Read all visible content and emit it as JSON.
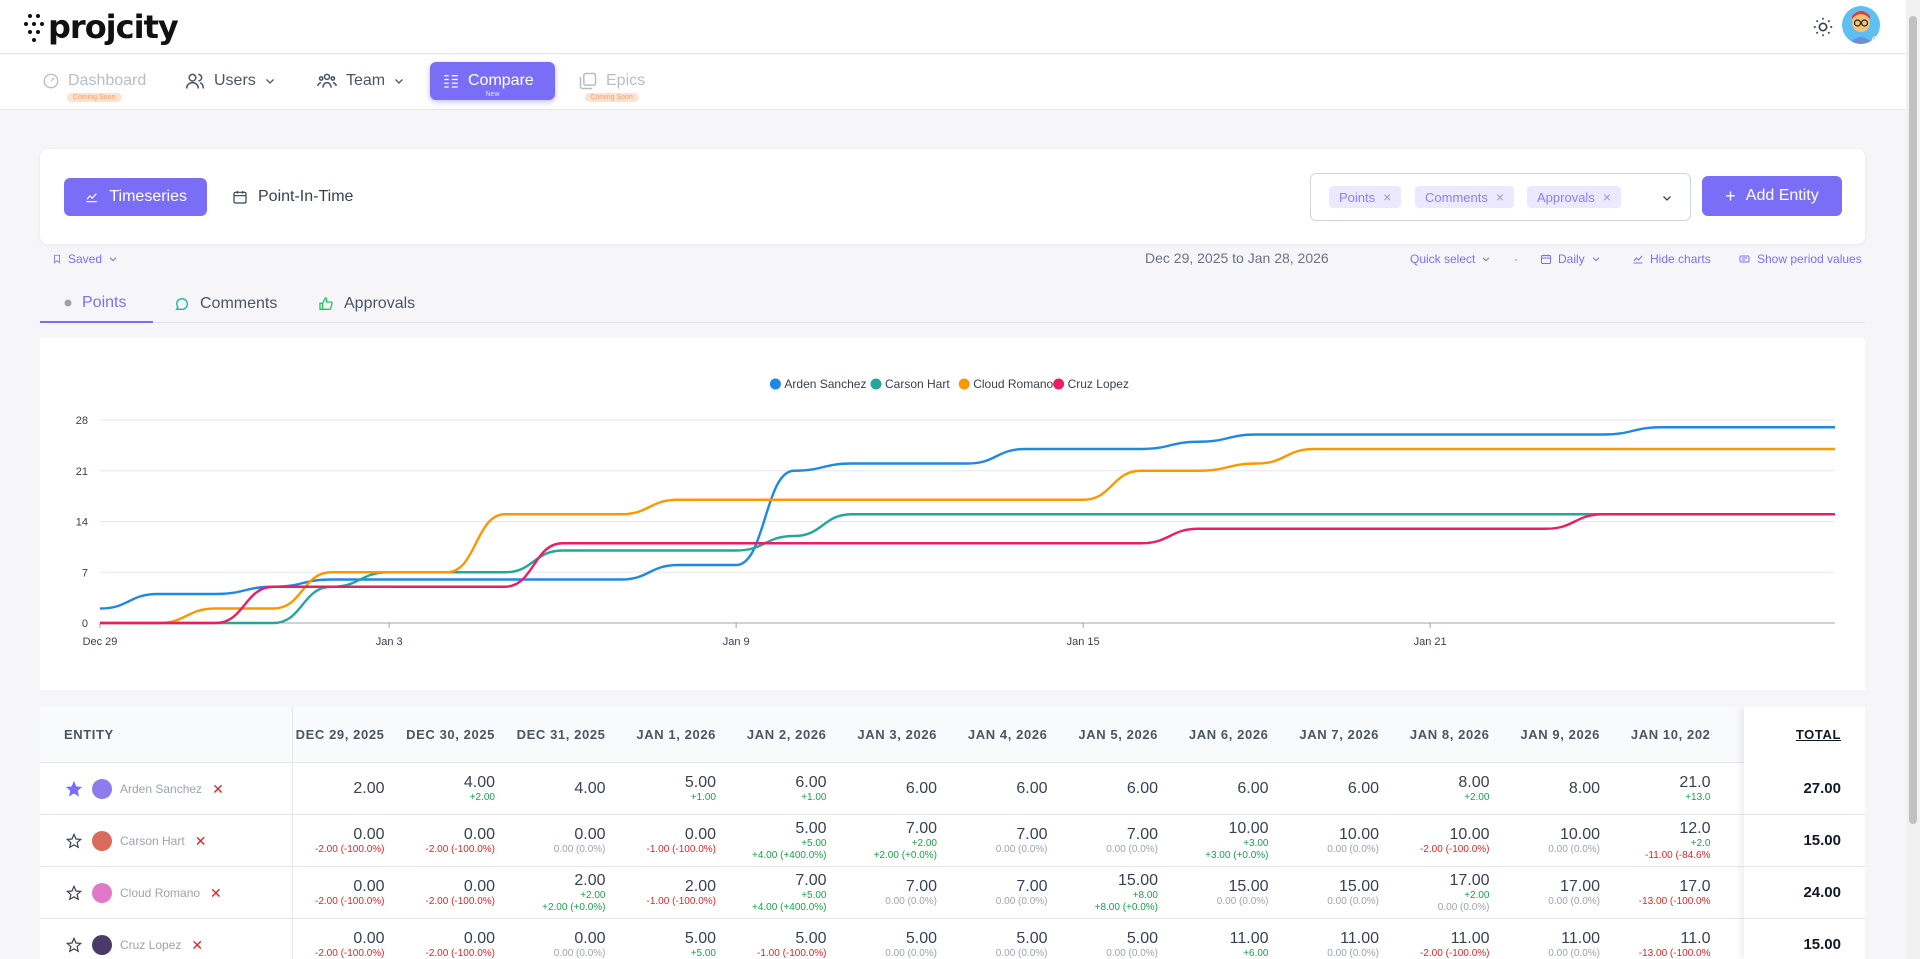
{
  "app": {
    "logo_text": "projcity"
  },
  "nav": [
    {
      "id": "dashboard",
      "label": "Dashboard",
      "badge": "Coming Soon",
      "state": "disabled"
    },
    {
      "id": "users",
      "label": "Users",
      "state": "normal"
    },
    {
      "id": "team",
      "label": "Team",
      "state": "normal"
    },
    {
      "id": "compare",
      "label": "Compare",
      "badge": "New",
      "state": "active"
    },
    {
      "id": "epics",
      "label": "Epics",
      "badge": "Coming Soon",
      "state": "disabled"
    }
  ],
  "view_toggle": {
    "timeseries": "Timeseries",
    "point_in_time": "Point-In-Time",
    "selected": "Timeseries"
  },
  "metrics_selected": [
    "Points",
    "Comments",
    "Approvals"
  ],
  "add_entity_label": "Add Entity",
  "filters": {
    "saved_label": "Saved",
    "date_range": "Dec 29, 2025 to Jan 28, 2026",
    "quick_select": "Quick select",
    "separator": "·",
    "granularity": "Daily",
    "hide_charts": "Hide charts",
    "show_period_values": "Show period values"
  },
  "metric_tabs": [
    {
      "id": "points",
      "label": "Points",
      "active": true
    },
    {
      "id": "comments",
      "label": "Comments",
      "active": false
    },
    {
      "id": "approvals",
      "label": "Approvals",
      "active": false
    }
  ],
  "chart_data": {
    "type": "line",
    "y_ticks": [
      "0",
      "7",
      "14",
      "21",
      "28"
    ],
    "ylim": [
      0,
      28
    ],
    "x_ticks": [
      "Dec 29",
      "Jan 3",
      "Jan 9",
      "Jan 15",
      "Jan 21"
    ],
    "x_tick_days": [
      0,
      5,
      11,
      17,
      23
    ],
    "x_days_total": 30,
    "legend_position": "top-center",
    "grid": true,
    "series": [
      {
        "name": "Arden Sanchez",
        "color": "#1e88e5",
        "values": [
          2,
          4,
          4,
          5,
          6,
          6,
          6,
          6,
          6,
          6,
          8,
          8,
          21,
          22,
          22,
          22,
          24,
          24,
          24,
          25,
          26,
          26,
          26,
          26,
          26,
          26,
          26,
          27,
          27,
          27,
          27
        ]
      },
      {
        "name": "Carson Hart",
        "color": "#26a69a",
        "values": [
          0,
          0,
          0,
          0,
          5,
          7,
          7,
          7,
          10,
          10,
          10,
          10,
          12,
          15,
          15,
          15,
          15,
          15,
          15,
          15,
          15,
          15,
          15,
          15,
          15,
          15,
          15,
          15,
          15,
          15,
          15
        ]
      },
      {
        "name": "Cloud Romano",
        "color": "#fb9800",
        "values": [
          0,
          0,
          2,
          2,
          7,
          7,
          7,
          15,
          15,
          15,
          17,
          17,
          17,
          17,
          17,
          17,
          17,
          17,
          21,
          21,
          22,
          24,
          24,
          24,
          24,
          24,
          24,
          24,
          24,
          24,
          24
        ]
      },
      {
        "name": "Cruz Lopez",
        "color": "#e91e63",
        "values": [
          0,
          0,
          0,
          5,
          5,
          5,
          5,
          5,
          11,
          11,
          11,
          11,
          11,
          11,
          11,
          11,
          11,
          11,
          11,
          13,
          13,
          13,
          13,
          13,
          13,
          13,
          15,
          15,
          15,
          15,
          15
        ]
      }
    ]
  },
  "table": {
    "entity_header": "ENTITY",
    "total_header": "TOTAL",
    "columns": [
      "DEC 29, 2025",
      "DEC 30, 2025",
      "DEC 31, 2025",
      "JAN 1, 2026",
      "JAN 2, 2026",
      "JAN 3, 2026",
      "JAN 4, 2026",
      "JAN 5, 2026",
      "JAN 6, 2026",
      "JAN 7, 2026",
      "JAN 8, 2026",
      "JAN 9, 2026",
      "JAN 10, 202"
    ],
    "rows": [
      {
        "name": "Arden Sanchez",
        "starred": true,
        "avatar_color": "#8c7cf0",
        "total": "27.00",
        "cells": [
          {
            "v": "2.00"
          },
          {
            "v": "4.00",
            "d1": "+2.00",
            "d1c": "pos"
          },
          {
            "v": "4.00"
          },
          {
            "v": "5.00",
            "d1": "+1.00",
            "d1c": "pos"
          },
          {
            "v": "6.00",
            "d1": "+1.00",
            "d1c": "pos"
          },
          {
            "v": "6.00"
          },
          {
            "v": "6.00"
          },
          {
            "v": "6.00"
          },
          {
            "v": "6.00"
          },
          {
            "v": "6.00"
          },
          {
            "v": "8.00",
            "d1": "+2.00",
            "d1c": "pos"
          },
          {
            "v": "8.00"
          },
          {
            "v": "21.0",
            "d1": "+13.0",
            "d1c": "pos"
          }
        ]
      },
      {
        "name": "Carson Hart",
        "starred": false,
        "avatar_color": "#d86b5a",
        "total": "15.00",
        "cells": [
          {
            "v": "0.00",
            "d2": "-2.00 (-100.0%)",
            "d2c": "neg"
          },
          {
            "v": "0.00",
            "d2": "-2.00 (-100.0%)",
            "d2c": "neg"
          },
          {
            "v": "0.00",
            "d2": "0.00 (0.0%)",
            "d2c": "zero"
          },
          {
            "v": "0.00",
            "d2": "-1.00 (-100.0%)",
            "d2c": "neg"
          },
          {
            "v": "5.00",
            "d1": "+5.00",
            "d1c": "pos",
            "d2": "+4.00 (+400.0%)",
            "d2c": "pos"
          },
          {
            "v": "7.00",
            "d1": "+2.00",
            "d1c": "pos",
            "d2": "+2.00 (+0.0%)",
            "d2c": "pos"
          },
          {
            "v": "7.00",
            "d2": "0.00 (0.0%)",
            "d2c": "zero"
          },
          {
            "v": "7.00",
            "d2": "0.00 (0.0%)",
            "d2c": "zero"
          },
          {
            "v": "10.00",
            "d1": "+3.00",
            "d1c": "pos",
            "d2": "+3.00 (+0.0%)",
            "d2c": "pos"
          },
          {
            "v": "10.00",
            "d2": "0.00 (0.0%)",
            "d2c": "zero"
          },
          {
            "v": "10.00",
            "d2": "-2.00 (-100.0%)",
            "d2c": "neg"
          },
          {
            "v": "10.00",
            "d2": "0.00 (0.0%)",
            "d2c": "zero"
          },
          {
            "v": "12.0",
            "d1": "+2.0",
            "d1c": "pos",
            "d2": "-11.00 (-84.6%",
            "d2c": "neg"
          }
        ]
      },
      {
        "name": "Cloud Romano",
        "starred": false,
        "avatar_color": "#e07ac8",
        "total": "24.00",
        "cells": [
          {
            "v": "0.00",
            "d2": "-2.00 (-100.0%)",
            "d2c": "neg"
          },
          {
            "v": "0.00",
            "d2": "-2.00 (-100.0%)",
            "d2c": "neg"
          },
          {
            "v": "2.00",
            "d1": "+2.00",
            "d1c": "pos",
            "d2": "+2.00 (+0.0%)",
            "d2c": "pos"
          },
          {
            "v": "2.00",
            "d2": "-1.00 (-100.0%)",
            "d2c": "neg"
          },
          {
            "v": "7.00",
            "d1": "+5.00",
            "d1c": "pos",
            "d2": "+4.00 (+400.0%)",
            "d2c": "pos"
          },
          {
            "v": "7.00",
            "d2": "0.00 (0.0%)",
            "d2c": "zero"
          },
          {
            "v": "7.00",
            "d2": "0.00 (0.0%)",
            "d2c": "zero"
          },
          {
            "v": "15.00",
            "d1": "+8.00",
            "d1c": "pos",
            "d2": "+8.00 (+0.0%)",
            "d2c": "pos"
          },
          {
            "v": "15.00",
            "d2": "0.00 (0.0%)",
            "d2c": "zero"
          },
          {
            "v": "15.00",
            "d2": "0.00 (0.0%)",
            "d2c": "zero"
          },
          {
            "v": "17.00",
            "d1": "+2.00",
            "d1c": "pos",
            "d2": "0.00 (0.0%)",
            "d2c": "zero"
          },
          {
            "v": "17.00",
            "d2": "0.00 (0.0%)",
            "d2c": "zero"
          },
          {
            "v": "17.0",
            "d2": "-13.00 (-100.0%",
            "d2c": "neg"
          }
        ]
      },
      {
        "name": "Cruz Lopez",
        "starred": false,
        "avatar_color": "#4a3a6a",
        "total": "15.00",
        "cells": [
          {
            "v": "0.00",
            "d2": "-2.00 (-100.0%)",
            "d2c": "neg"
          },
          {
            "v": "0.00",
            "d2": "-2.00 (-100.0%)",
            "d2c": "neg"
          },
          {
            "v": "0.00",
            "d2": "0.00 (0.0%)",
            "d2c": "zero"
          },
          {
            "v": "5.00",
            "d1": "+5.00",
            "d1c": "pos"
          },
          {
            "v": "5.00",
            "d2": "-1.00 (-100.0%)",
            "d2c": "neg"
          },
          {
            "v": "5.00",
            "d2": "0.00 (0.0%)",
            "d2c": "zero"
          },
          {
            "v": "5.00",
            "d2": "0.00 (0.0%)",
            "d2c": "zero"
          },
          {
            "v": "5.00",
            "d2": "0.00 (0.0%)",
            "d2c": "zero"
          },
          {
            "v": "11.00",
            "d1": "+6.00",
            "d1c": "pos"
          },
          {
            "v": "11.00",
            "d2": "0.00 (0.0%)",
            "d2c": "zero"
          },
          {
            "v": "11.00",
            "d2": "-2.00 (-100.0%)",
            "d2c": "neg"
          },
          {
            "v": "11.00",
            "d2": "0.00 (0.0%)",
            "d2c": "zero"
          },
          {
            "v": "11.0",
            "d2": "-13.00 (-100.0%",
            "d2c": "neg"
          }
        ]
      }
    ]
  }
}
